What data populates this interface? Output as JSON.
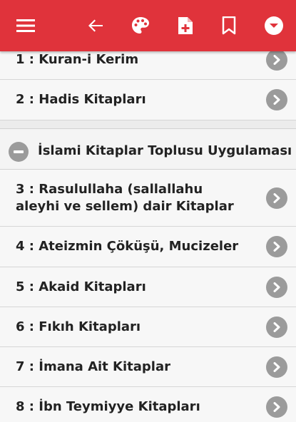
{
  "toolbar": {
    "color": "#e0333b",
    "icons": [
      "menu-icon",
      "back-arrow-icon",
      "palette-icon",
      "add-document-icon",
      "bookmark-icon",
      "dropdown-icon"
    ]
  },
  "list": {
    "top_items": [
      {
        "label": "1 : Kuran-i Kerim"
      },
      {
        "label": "2 : Hadis Kitapları"
      }
    ],
    "group": {
      "label": "İslami Kitaplar Toplusu Uygulaması",
      "items": [
        {
          "label": "3 : Rasulullaha (sallallahu aleyhi ve sellem) dair Kitaplar"
        },
        {
          "label": "4 : Ateizmin Çöküşü, Mucizeler"
        },
        {
          "label": "5 : Akaid Kitapları"
        },
        {
          "label": "6 : Fıkıh Kitapları"
        },
        {
          "label": "7 : İmana Ait Kitaplar"
        },
        {
          "label": "8 : İbn Teymiyye Kitapları"
        }
      ]
    }
  }
}
